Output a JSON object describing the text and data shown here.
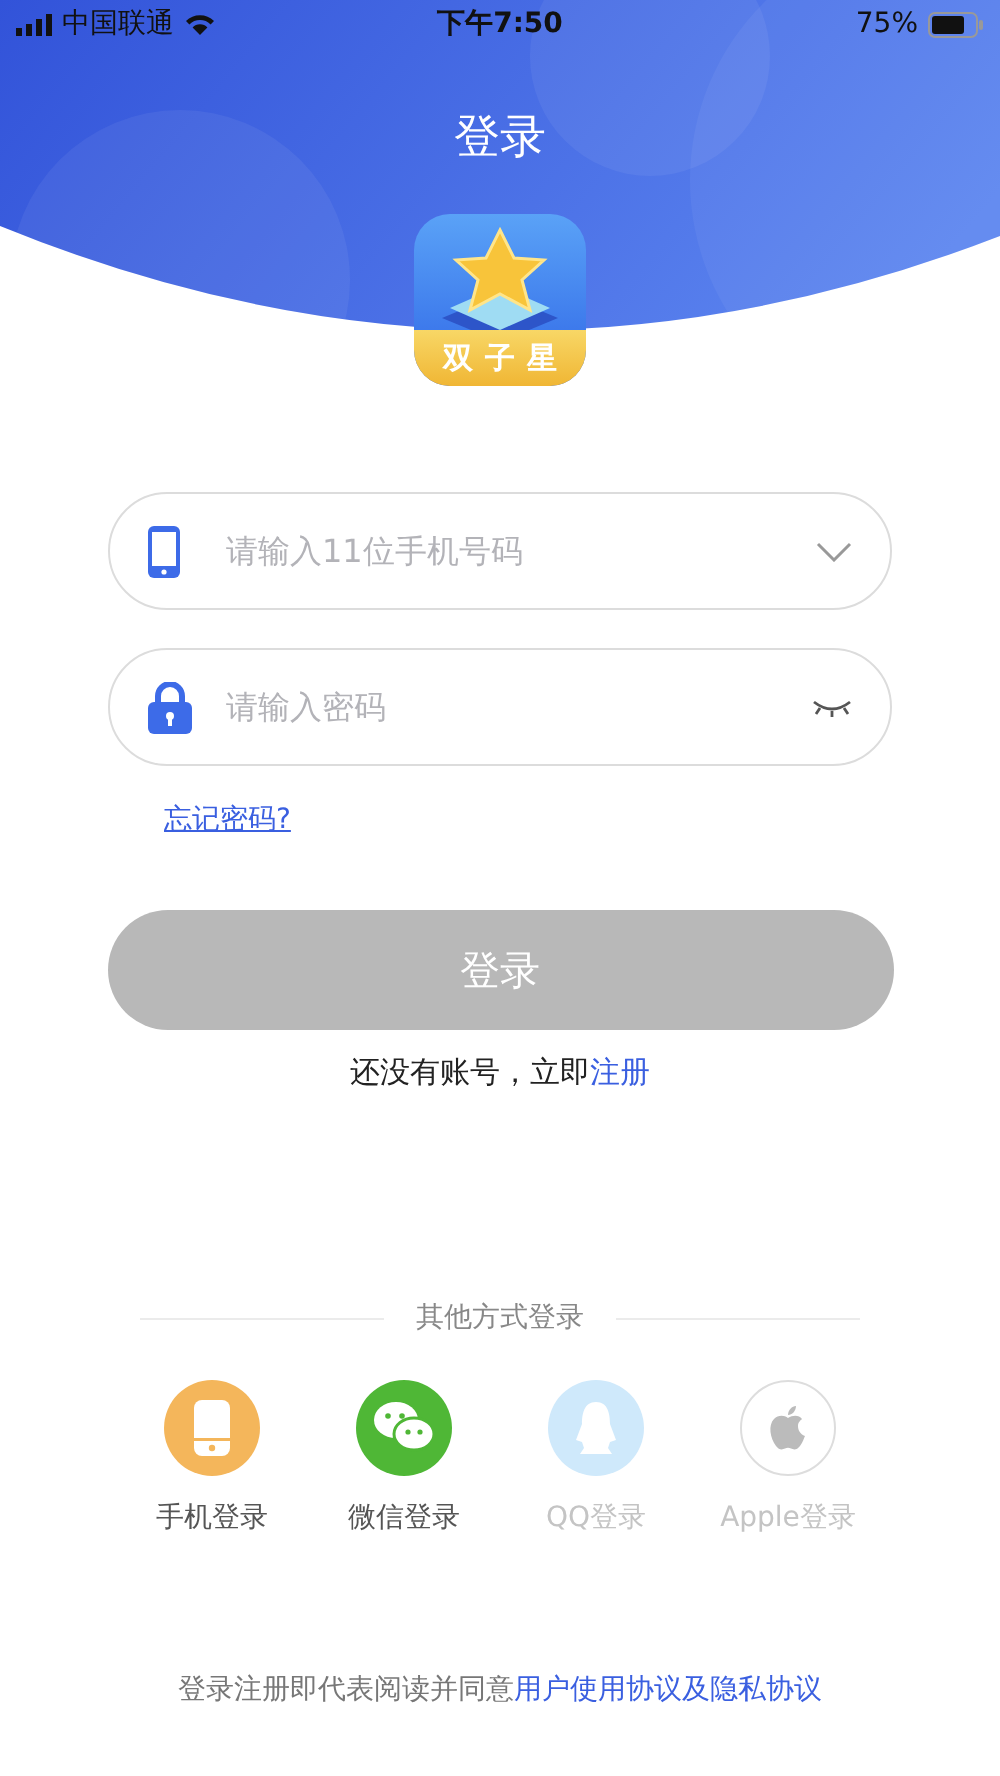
{
  "status_bar": {
    "carrier": "中国联通",
    "time": "下午7:50",
    "battery": "75%"
  },
  "title": "登录",
  "logo_text": "双子星",
  "phone_field": {
    "placeholder": "请输入11位手机号码"
  },
  "password_field": {
    "placeholder": "请输入密码"
  },
  "forgot_link": "忘记密码?",
  "login_button": {
    "label": "登录",
    "disabled": true
  },
  "register_prompt": {
    "text": "还没有账号，立即",
    "link": "注册"
  },
  "other_login": {
    "title": "其他方式登录",
    "options": [
      {
        "kind": "phone",
        "label": "手机登录",
        "color": "#f4b65b",
        "disabled": false
      },
      {
        "kind": "wechat",
        "label": "微信登录",
        "color": "#4fb736",
        "disabled": false
      },
      {
        "kind": "qq",
        "label": "QQ登录",
        "color": "#cfe9fb",
        "disabled": true
      },
      {
        "kind": "apple",
        "label": "Apple登录",
        "color": "#ffffff",
        "disabled": true
      }
    ]
  },
  "agreement": {
    "text": "登录注册即代表阅读并同意",
    "link": "用户使用协议及隐私协议"
  }
}
